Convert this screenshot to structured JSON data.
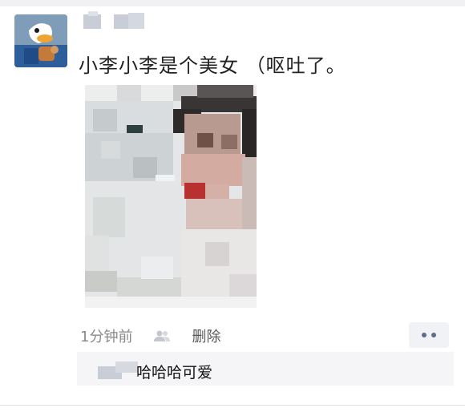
{
  "post": {
    "text": "小李小李是个美女 （呕吐了。",
    "time": "1分钟前",
    "delete_label": "删除"
  },
  "comment": {
    "text": "哈哈哈可爱"
  },
  "icons": {
    "visibility": "people-icon",
    "more": "more-dots-icon"
  },
  "colors": {
    "link_blue": "#5d6c88",
    "muted_text": "#8a8a8a",
    "comment_bg": "#f5f5f7"
  }
}
